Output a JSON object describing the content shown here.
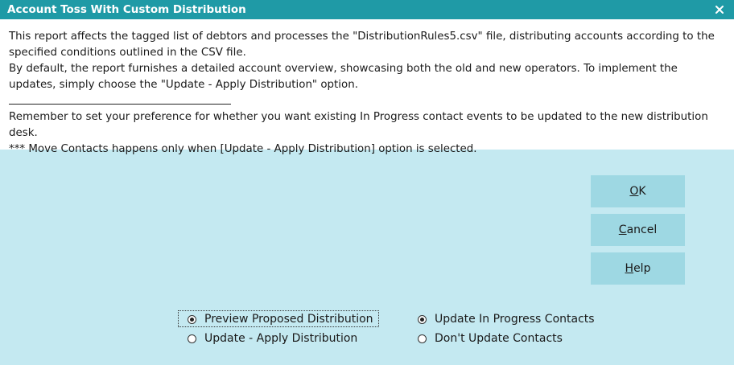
{
  "window": {
    "title": "Account Toss With Custom Distribution",
    "close_glyph": "✕"
  },
  "description": {
    "line1": "This report affects the tagged list of debtors and processes the \"DistributionRules5.csv\" file, distributing accounts according to the specified conditions outlined in the CSV file.",
    "line2": "By default, the report furnishes a detailed account overview, showcasing both the old and new operators. To implement the updates, simply choose the \"Update - Apply Distribution\" option.",
    "line3": "Remember to set your preference for whether you want existing In Progress contact events to be updated to the new distribution desk.",
    "line4": "*** Move Contacts happens only when [Update - Apply Distribution] option is selected."
  },
  "buttons": {
    "ok": {
      "mnemonic": "O",
      "rest": "K"
    },
    "cancel": {
      "mnemonic": "C",
      "rest": "ancel"
    },
    "help": {
      "mnemonic": "H",
      "rest": "elp"
    }
  },
  "mode_options": {
    "preview": {
      "label": "Preview Proposed Distribution",
      "selected": true
    },
    "apply": {
      "label": "Update - Apply Distribution",
      "selected": false
    }
  },
  "contact_options": {
    "update": {
      "label": "Update In Progress Contacts",
      "selected": true
    },
    "dont": {
      "label": "Don't Update Contacts",
      "selected": false
    }
  },
  "colors": {
    "titlebar": "#1f9aa6",
    "body": "#c4e9f1",
    "button": "#9ed8e3",
    "description_bg": "#ffffff"
  },
  "icons": {
    "close": "close-icon"
  }
}
